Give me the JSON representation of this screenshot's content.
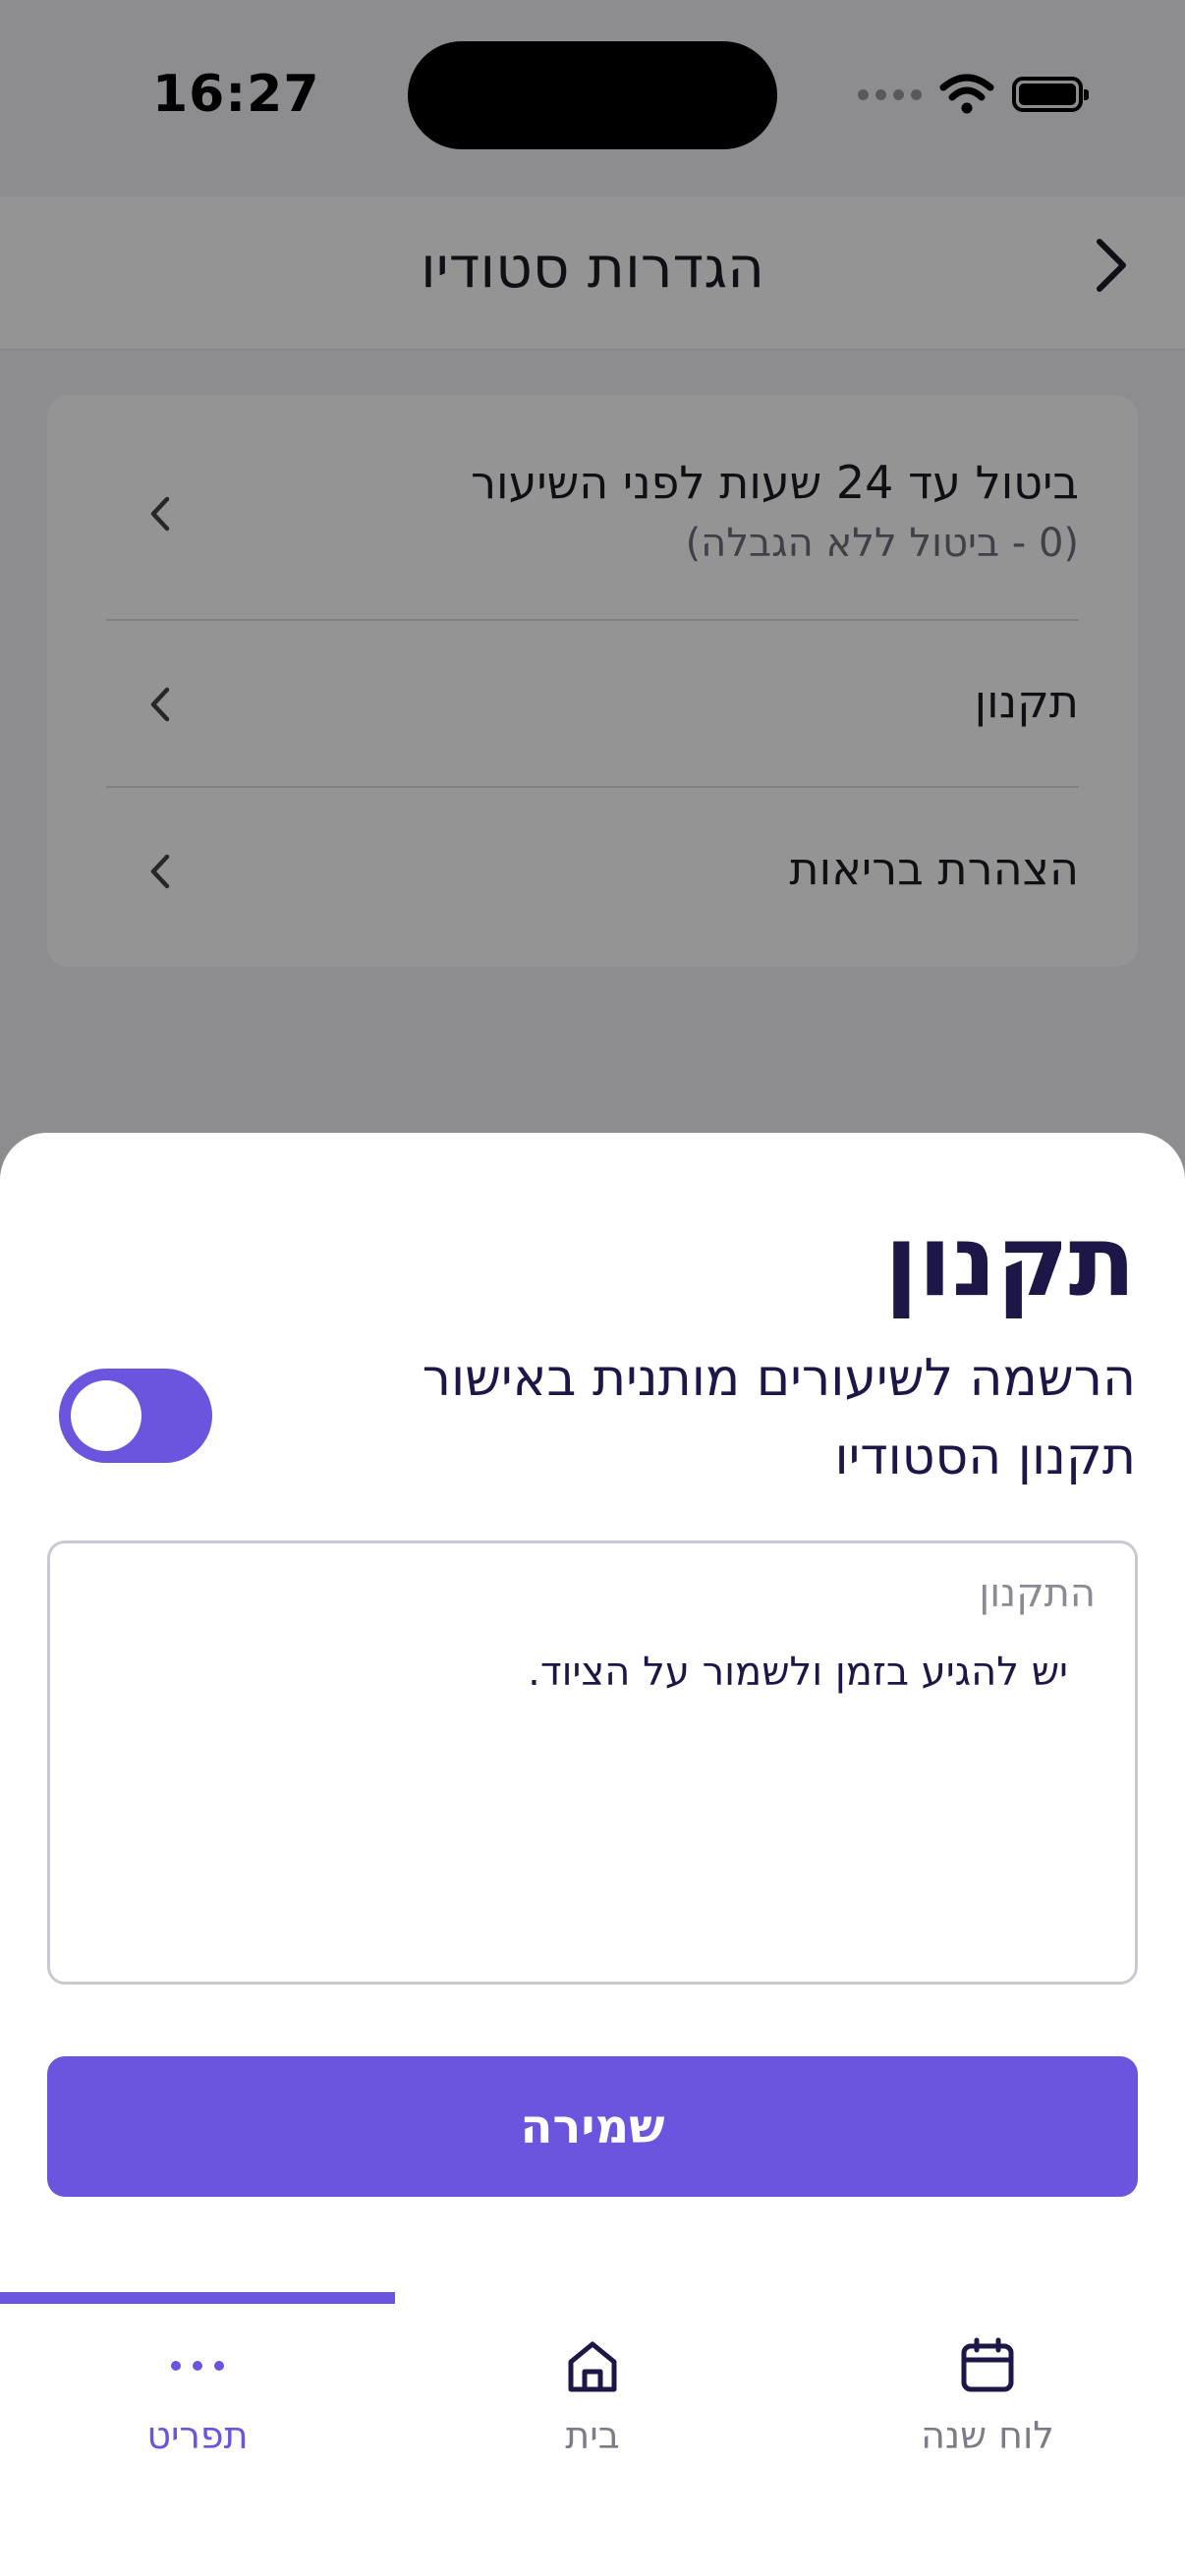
{
  "status_bar": {
    "time": "16:27"
  },
  "header": {
    "title": "הגדרות סטודיו"
  },
  "settings": {
    "items": [
      {
        "title": "ביטול עד 24 שעות לפני השיעור",
        "subtitle": "(0 - ביטול ללא הגבלה)"
      },
      {
        "title": "תקנון"
      },
      {
        "title": "הצהרת בריאות"
      }
    ]
  },
  "sheet": {
    "title": "תקנון",
    "toggle_label": "הרשמה לשיעורים מותנית באישור תקנון הסטודיו",
    "toggle_on": true,
    "textarea": {
      "label": "התקנון",
      "value": "יש להגיע בזמן ולשמור על הציוד."
    },
    "save_label": "שמירה"
  },
  "tabbar": {
    "tabs": [
      {
        "label": "תפריט",
        "icon": "more-dots-icon",
        "active": true
      },
      {
        "label": "בית",
        "icon": "home-icon",
        "active": false
      },
      {
        "label": "לוח שנה",
        "icon": "calendar-icon",
        "active": false
      }
    ]
  },
  "colors": {
    "accent": "#6b54de",
    "text": "#1c1747",
    "muted": "#7c7c88"
  }
}
